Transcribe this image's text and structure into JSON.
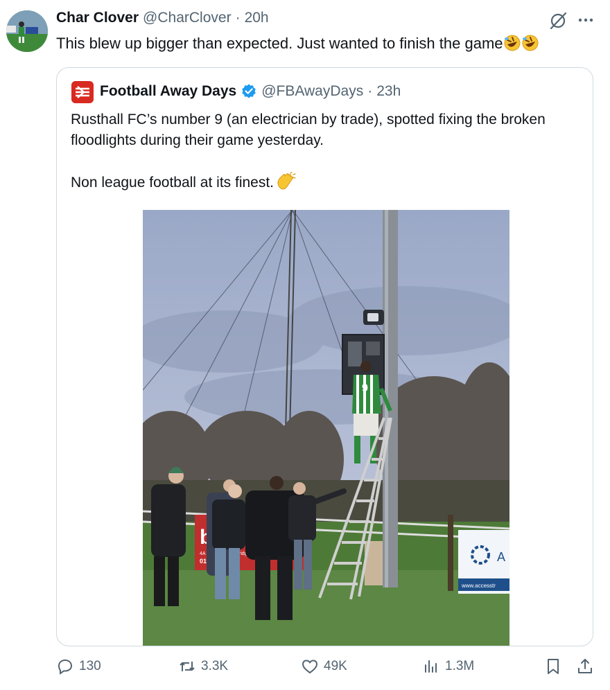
{
  "author": {
    "name": "Char Clover",
    "handle": "@CharClover",
    "separator": "·",
    "time": "20h",
    "text": "This blew up bigger than expected. Just wanted to finish the game",
    "emoji": [
      "rolling-on-floor-laughing",
      "rolling-on-floor-laughing"
    ]
  },
  "quoted": {
    "name": "Football Away Days",
    "verified": true,
    "handle": "@FBAwayDays",
    "separator": "·",
    "time": "23h",
    "paragraph1": "Rusthall FC’s number 9 (an electrician by trade), spotted fixing the broken floodlights during their game yesterday.",
    "paragraph2": "Non league football at its finest.",
    "paragraph2_emoji": "clapping-hands",
    "photo": {
      "shirt_number": "9",
      "banner_left": "b",
      "banner_left_phone_start": "0173",
      "banner_left_phone_end": "35",
      "banner_left_small1": "4A H",
      "banner_left_small2": "bridge, K",
      "banner_right": "A",
      "banner_right_url": "www.accesstr"
    }
  },
  "actions": {
    "replies": "130",
    "reposts": "3.3K",
    "likes": "49K",
    "views": "1.3M"
  },
  "colors": {
    "text_primary": "#0f1419",
    "text_secondary": "#536471",
    "border": "#cfd9de",
    "verified": "#1d9bf0",
    "kit_green": "#2f8a3e"
  }
}
